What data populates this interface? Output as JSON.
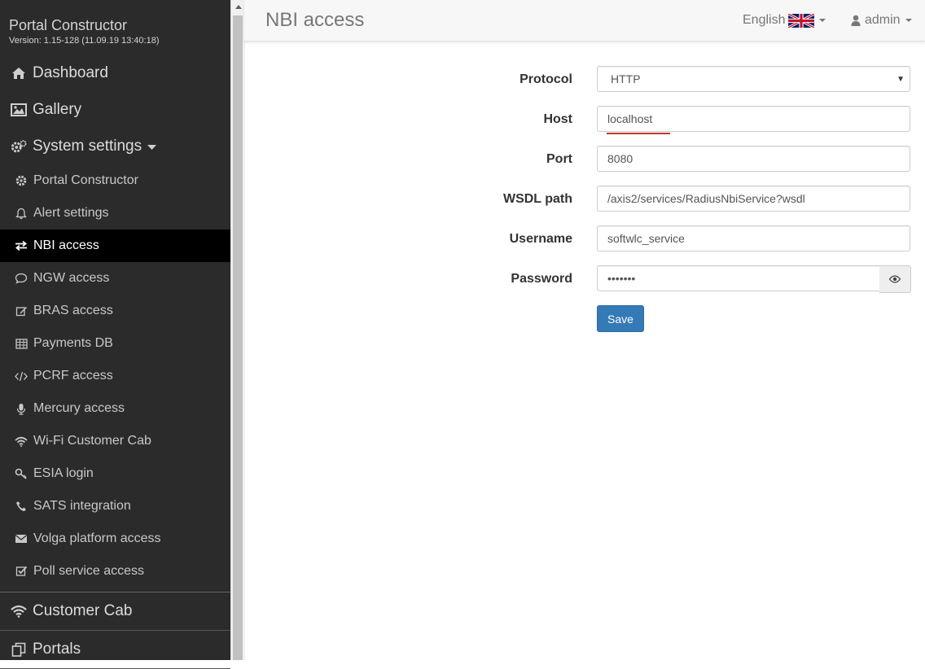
{
  "app": {
    "title": "Portal Constructor",
    "version": "Version: 1.15-128 (11.09.19 13:40:18)"
  },
  "sidebar": {
    "top_items": [
      {
        "label": "Dashboard",
        "icon": "home-icon"
      },
      {
        "label": "Gallery",
        "icon": "image-icon"
      },
      {
        "label": "System settings",
        "icon": "gears-icon"
      }
    ],
    "sub_items": [
      {
        "label": "Portal Constructor",
        "icon": "gear-icon"
      },
      {
        "label": "Alert settings",
        "icon": "bell-icon"
      },
      {
        "label": "NBI access",
        "icon": "exchange-icon",
        "active": true
      },
      {
        "label": "NGW access",
        "icon": "comment-icon"
      },
      {
        "label": "BRAS access",
        "icon": "edit-icon"
      },
      {
        "label": "Payments DB",
        "icon": "table-icon"
      },
      {
        "label": "PCRF access",
        "icon": "code-icon"
      },
      {
        "label": "Mercury access",
        "icon": "microphone-icon"
      },
      {
        "label": "Wi-Fi Customer Cab",
        "icon": "wifi-icon"
      },
      {
        "label": "ESIA login",
        "icon": "key-icon"
      },
      {
        "label": "SATS integration",
        "icon": "phone-icon"
      },
      {
        "label": "Volga platform access",
        "icon": "envelope-icon"
      },
      {
        "label": "Poll service access",
        "icon": "check-square-icon"
      }
    ],
    "bottom_items": [
      {
        "label": "Customer Cab",
        "icon": "wifi-icon"
      },
      {
        "label": "Portals",
        "icon": "copy-icon"
      }
    ]
  },
  "header": {
    "title": "NBI access",
    "language": "English",
    "user": "admin"
  },
  "form": {
    "protocol_label": "Protocol",
    "protocol_value": "HTTP",
    "host_label": "Host",
    "host_value": "localhost",
    "port_label": "Port",
    "port_value": "8080",
    "wsdl_label": "WSDL path",
    "wsdl_value": "/axis2/services/RadiusNbiService?wsdl",
    "username_label": "Username",
    "username_value": "softwlc_service",
    "password_label": "Password",
    "password_value": "•••••••",
    "save_label": "Save"
  },
  "colors": {
    "sidebar_bg": "#2b2b2b",
    "active_bg": "#000000",
    "primary_button": "#337ab7"
  }
}
